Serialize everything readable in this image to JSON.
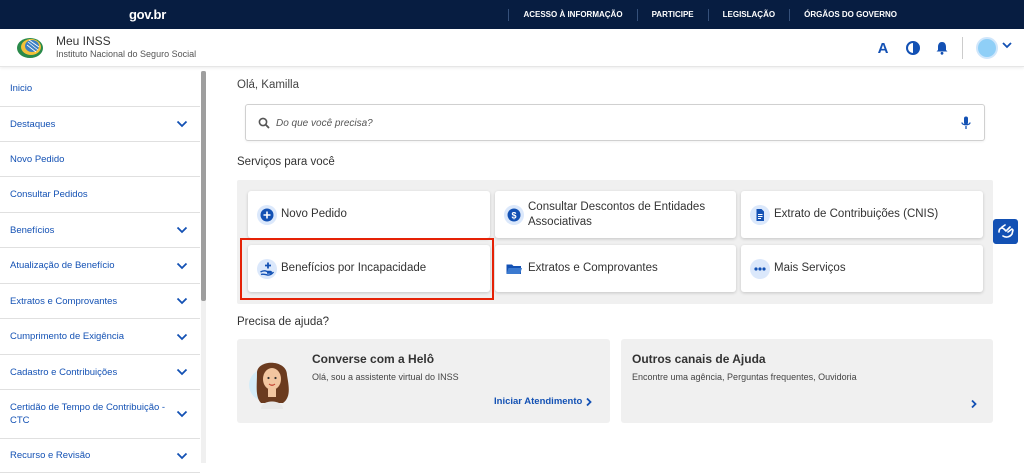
{
  "gov_bar": {
    "logo": "gov.br",
    "links": [
      "ACESSO À INFORMAÇÃO",
      "PARTICIPE",
      "LEGISLAÇÃO",
      "ÓRGÃOS DO GOVERNO"
    ]
  },
  "header": {
    "title": "Meu INSS",
    "subtitle": "Instituto Nacional do Seguro Social",
    "font_size_button": "A",
    "icons": [
      "font-size-icon",
      "contrast-icon",
      "bell-icon",
      "avatar",
      "chevron-down-icon"
    ]
  },
  "sidebar": {
    "items": [
      {
        "label": "Inicio",
        "expandable": false
      },
      {
        "label": "Destaques",
        "expandable": true
      },
      {
        "label": "Novo Pedido",
        "expandable": false
      },
      {
        "label": "Consultar Pedidos",
        "expandable": false
      },
      {
        "label": "Benefícios",
        "expandable": true
      },
      {
        "label": "Atualização de Benefício",
        "expandable": true
      },
      {
        "label": "Extratos e Comprovantes",
        "expandable": true
      },
      {
        "label": "Cumprimento de Exigência",
        "expandable": true
      },
      {
        "label": "Cadastro e Contribuições",
        "expandable": true
      },
      {
        "label": "Certidão de Tempo de Contribuição - CTC",
        "expandable": true
      },
      {
        "label": "Recurso e Revisão",
        "expandable": true
      }
    ]
  },
  "main": {
    "greeting": "Olá, Kamilla",
    "search_placeholder": "Do que você precisa?",
    "services_title": "Serviços para você",
    "services": [
      {
        "label": "Novo Pedido",
        "icon": "plus-circle-icon"
      },
      {
        "label": "Consultar Descontos de Entidades Associativas",
        "icon": "money-icon"
      },
      {
        "label": "Extrato de Contribuições (CNIS)",
        "icon": "document-icon"
      },
      {
        "label": "Benefícios por Incapacidade",
        "icon": "hand-plus-icon"
      },
      {
        "label": "Extratos e Comprovantes",
        "icon": "folder-icon"
      },
      {
        "label": "Mais Serviços",
        "icon": "more-icon"
      }
    ],
    "help_title": "Precisa de ajuda?",
    "help_cards": [
      {
        "title": "Converse com a Helô",
        "desc": "Olá, sou a assistente virtual do INSS",
        "link": "Iniciar Atendimento"
      },
      {
        "title": "Outros canais de Ajuda",
        "desc": "Encontre uma agência, Perguntas frequentes, Ouvidoria",
        "link": ""
      }
    ]
  },
  "colors": {
    "gov_bar": "#071d41",
    "primary": "#1351b4",
    "highlight": "#e52207",
    "panel": "#f0f0f0"
  }
}
